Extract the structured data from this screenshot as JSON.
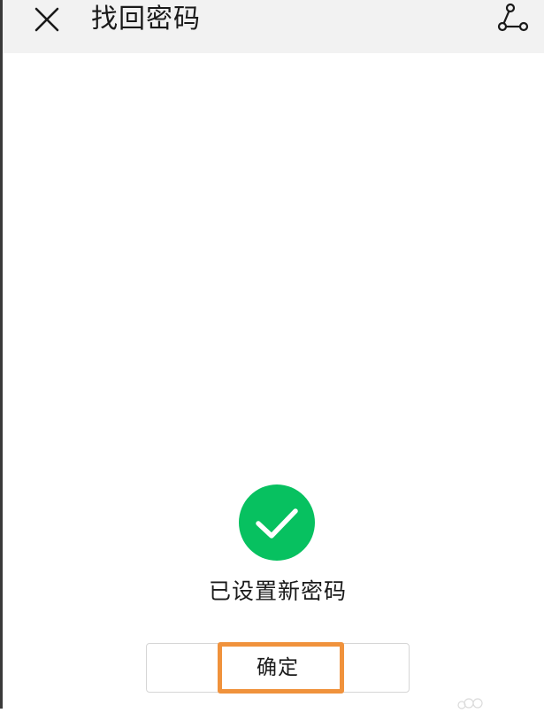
{
  "header": {
    "title": "找回密码",
    "close_icon": "close-icon",
    "share_icon": "share-icon"
  },
  "result": {
    "icon": "check-circle-icon",
    "status_text": "已设置新密码",
    "icon_color": "#07c160"
  },
  "actions": {
    "confirm_label": "确定"
  },
  "highlight": {
    "color": "#f0923c"
  }
}
